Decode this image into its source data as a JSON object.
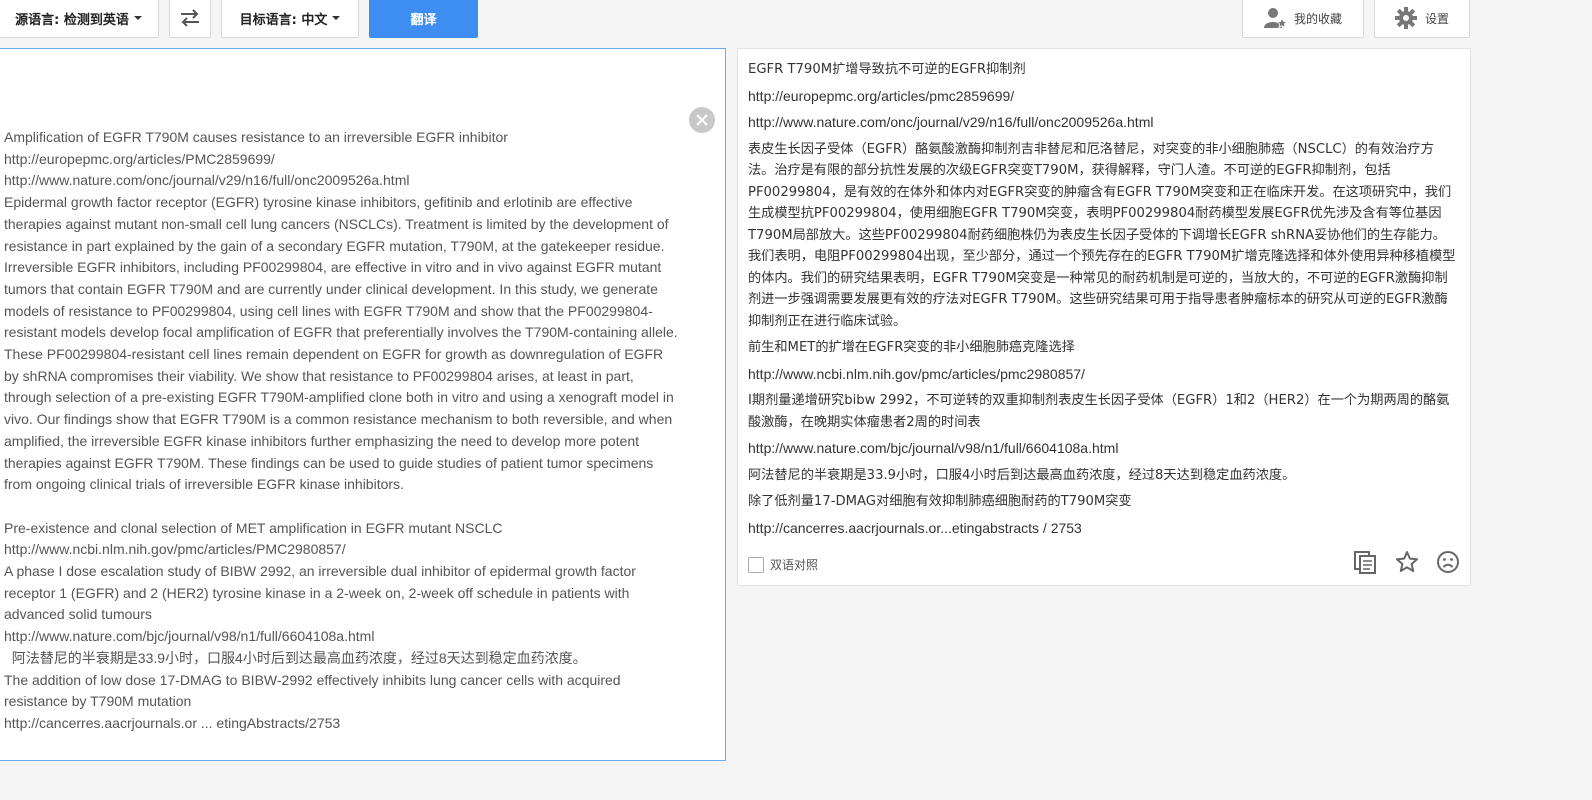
{
  "toolbar": {
    "source_lang_label": "源语言: 检测到英语",
    "target_lang_label": "目标语言: 中文",
    "translate_label": "翻译",
    "favorites_label": "我的收藏",
    "settings_label": "设置"
  },
  "source": {
    "lines": [
      "Amplification of EGFR T790M causes resistance to an irreversible EGFR inhibitor",
      "http://europepmc.org/articles/PMC2859699/",
      "http://www.nature.com/onc/journal/v29/n16/full/onc2009526a.html",
      "Epidermal growth factor receptor (EGFR) tyrosine kinase inhibitors, gefitinib and erlotinib are effective",
      "therapies against mutant non-small cell lung cancers (NSCLCs). Treatment is limited by the development of",
      "resistance in part explained by the gain of a secondary EGFR mutation, T790M, at the gatekeeper residue.",
      "Irreversible EGFR inhibitors, including PF00299804, are effective in vitro and in vivo against EGFR mutant",
      "tumors that contain EGFR T790M and are currently under clinical development. In this study, we generate",
      "models of resistance to PF00299804, using cell lines with EGFR T790M and show that the PF00299804-",
      "resistant models develop focal amplification of EGFR that preferentially involves the T790M-containing allele.",
      "These PF00299804-resistant cell lines remain dependent on EGFR for growth as downregulation of EGFR",
      "by shRNA compromises their viability. We show that resistance to PF00299804 arises, at least in part,",
      "through selection of a pre-existing EGFR T790M-amplified clone both in vitro and using a xenograft model in",
      "vivo. Our findings show that EGFR T790M is a common resistance mechanism to both reversible, and when",
      "amplified, the irreversible EGFR kinase inhibitors further emphasizing the need to develop more potent",
      "therapies against EGFR T790M. These findings can be used to guide studies of patient tumor specimens",
      "from ongoing clinical trials of irreversible EGFR kinase inhibitors.",
      "",
      "Pre-existence and clonal selection of MET amplification in EGFR mutant NSCLC",
      "http://www.ncbi.nlm.nih.gov/pmc/articles/PMC2980857/",
      "A phase I dose escalation study of BIBW 2992, an irreversible dual inhibitor of epidermal growth factor",
      "receptor 1 (EGFR) and 2 (HER2) tyrosine kinase in a 2-week on, 2-week off schedule in patients with",
      "advanced solid tumours",
      "http://www.nature.com/bjc/journal/v98/n1/full/6604108a.html",
      "  阿法替尼的半衰期是33.9小时，口服4小时后到达最高血药浓度，经过8天达到稳定血药浓度。",
      "The addition of low dose 17-DMAG to BIBW-2992 effectively inhibits lung cancer cells with acquired",
      "resistance by T790M mutation",
      "http://cancerres.aacrjournals.or ... etingAbstracts/2753"
    ]
  },
  "target": {
    "paragraphs": [
      {
        "text": "EGFR T790M扩增导致抗不可逆的EGFR抑制剂",
        "url": false
      },
      {
        "text": "http://europepmc.org/articles/pmc2859699/",
        "url": true
      },
      {
        "text": "http://www.nature.com/onc/journal/v29/n16/full/onc2009526a.html",
        "url": true
      },
      {
        "text": "表皮生长因子受体（EGFR）酪氨酸激酶抑制剂吉非替尼和厄洛替尼，对突变的非小细胞肺癌（NSCLC）的有效治疗方法。治疗是有限的部分抗性发展的次级EGFR突变T790M，获得解释，守门人渣。不可逆的EGFR抑制剂，包括PF00299804，是有效的在体外和体内对EGFR突变的肿瘤含有EGFR T790M突变和正在临床开发。在这项研究中，我们生成模型抗PF00299804，使用细胞EGFR T790M突变，表明PF00299804耐药模型发展EGFR优先涉及含有等位基因T790M局部放大。这些PF00299804耐药细胞株仍为表皮生长因子受体的下调增长EGFR shRNA妥协他们的生存能力。我们表明，电阻PF00299804出现，至少部分，通过一个预先存在的EGFR T790M扩增克隆选择和体外使用异种移植模型的体内。我们的研究结果表明，EGFR T790M突变是一种常见的耐药机制是可逆的，当放大的，不可逆的EGFR激酶抑制剂进一步强调需要发展更有效的疗法对EGFR T790M。这些研究结果可用于指导患者肿瘤标本的研究从可逆的EGFR激酶抑制剂正在进行临床试验。",
        "url": false
      },
      {
        "text": "前生和MET的扩增在EGFR突变的非小细胞肺癌克隆选择",
        "url": false
      },
      {
        "text": "http://www.ncbi.nlm.nih.gov/pmc/articles/pmc2980857/",
        "url": true
      },
      {
        "text": "I期剂量递增研究bibw 2992，不可逆转的双重抑制剂表皮生长因子受体（EGFR）1和2（HER2）在一个为期两周的酪氨酸激酶，在晚期实体瘤患者2周的时间表",
        "url": false
      },
      {
        "text": "http://www.nature.com/bjc/journal/v98/n1/full/6604108a.html",
        "url": true
      },
      {
        "text": "阿法替尼的半衰期是33.9小时，口服4小时后到达最高血药浓度，经过8天达到稳定血药浓度。",
        "url": false
      },
      {
        "text": "除了低剂量17-DMAG对细胞有效抑制肺癌细胞耐药的T790M突变",
        "url": false
      },
      {
        "text": "http://cancerres.aacrjournals.or...etingabstracts / 2753",
        "url": true
      }
    ],
    "bilingual_label": "双语对照"
  }
}
